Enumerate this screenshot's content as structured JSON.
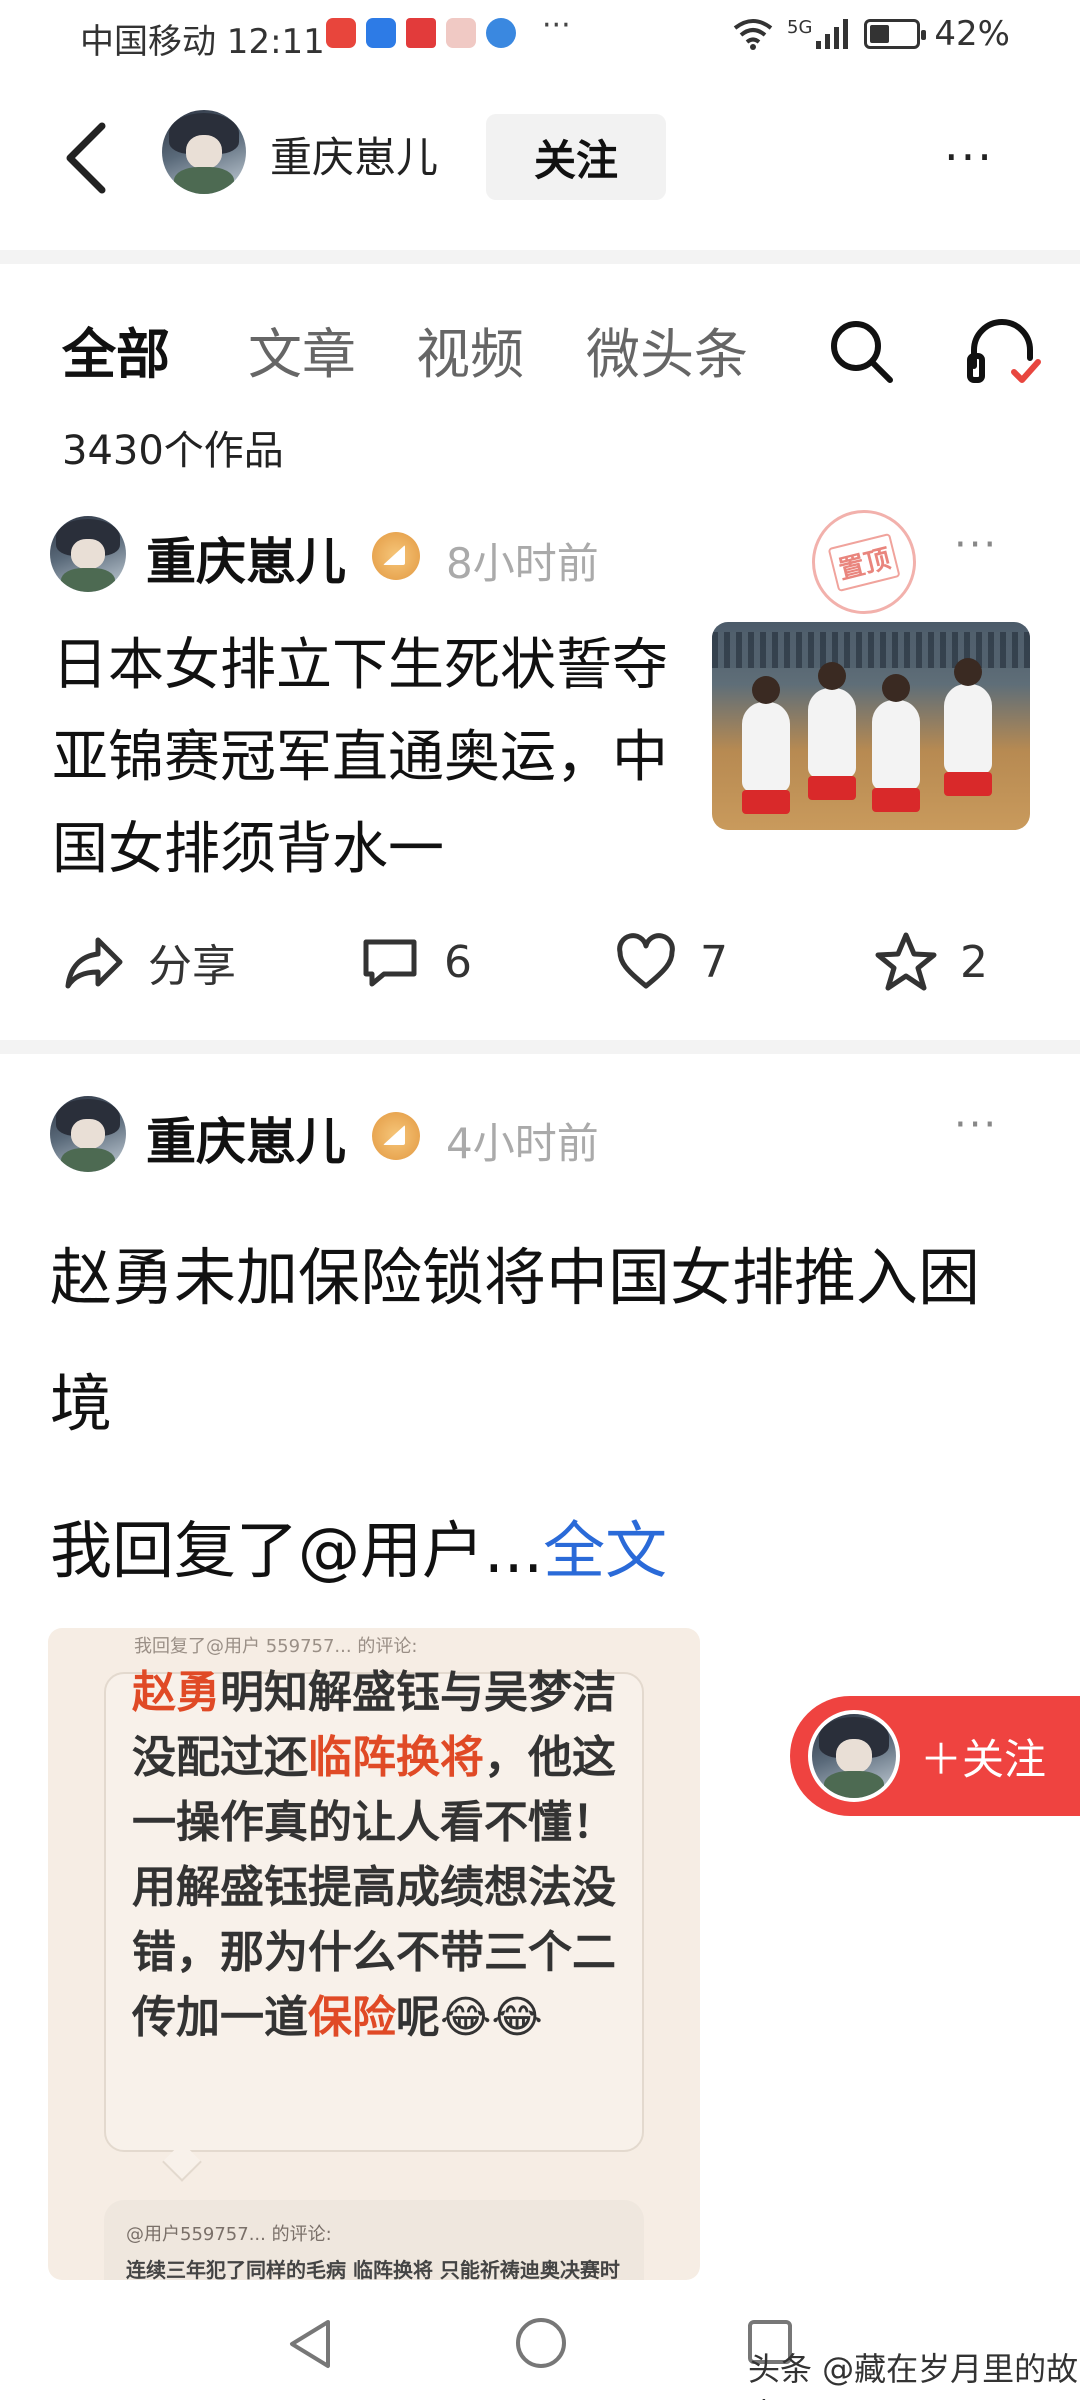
{
  "status_bar": {
    "carrier_time": "中国移动 12:11",
    "more": "···",
    "network": "5G",
    "battery": "42%",
    "battery_level": 0.42
  },
  "header": {
    "username": "重庆崽儿",
    "follow_label": "关注",
    "more": "···"
  },
  "tabs": [
    {
      "label": "全部",
      "active": true
    },
    {
      "label": "文章",
      "active": false
    },
    {
      "label": "视频",
      "active": false
    },
    {
      "label": "微头条",
      "active": false
    }
  ],
  "works_count": "3430个作品",
  "feed": [
    {
      "author": "重庆崽儿",
      "time": "8小时前",
      "pinned_label": "置顶",
      "title": "日本女排立下生死状誓夺亚锦赛冠军直通奥运，中国女排须背水一",
      "actions": {
        "share": "分享",
        "comments": "6",
        "likes": "7",
        "favorites": "2"
      }
    },
    {
      "author": "重庆崽儿",
      "time": "4小时前",
      "title": "赵勇未加保险锁将中国女排推入困境",
      "reply_prefix": "我回复了@用户...",
      "full_text_link": "全文",
      "image": {
        "top_line": "我回复了@用户 559757... 的评论:",
        "segments": [
          {
            "text": "赵勇",
            "hl": true
          },
          {
            "text": "明知解盛钰与吴梦洁没配过还",
            "hl": false
          },
          {
            "text": "临阵换将",
            "hl": true
          },
          {
            "text": "，他这一操作真的让人看不懂！用解盛钰提高成绩想法没错，那为什么不带三个二传加一道",
            "hl": false
          },
          {
            "text": "保险",
            "hl": true
          },
          {
            "text": "呢😂😂",
            "hl": false
          }
        ],
        "second_user": "@用户559757... 的评论:",
        "second_text": "连续三年犯了同样的毛病 临阵换将   只能祈祷迪奥决赛时"
      }
    }
  ],
  "floating_follow": "＋关注",
  "watermark": "头条 @藏在岁月里的故事",
  "colors": {
    "accent_red": "#ef4340",
    "highlight": "#e04a26",
    "link_blue": "#2a6ad8"
  }
}
